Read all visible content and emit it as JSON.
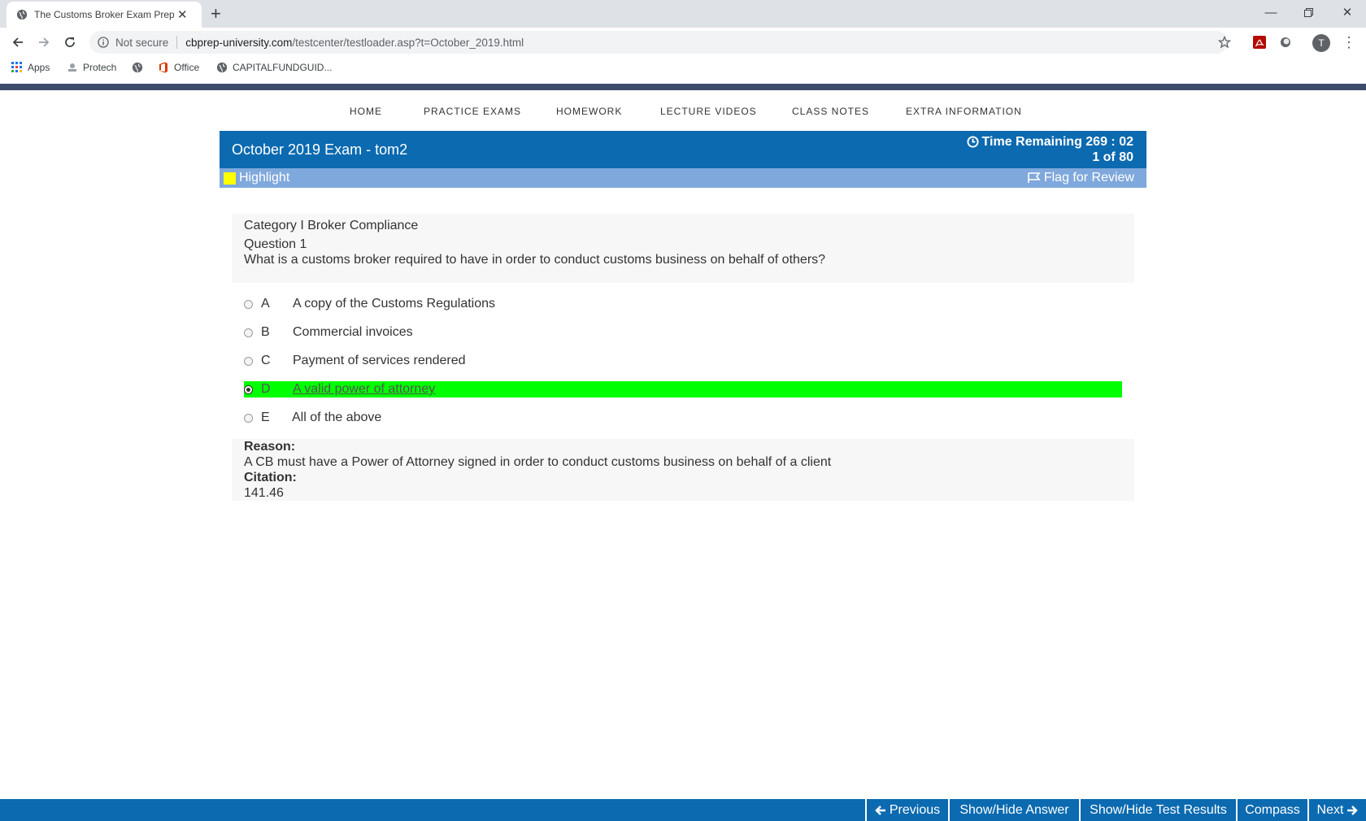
{
  "browser": {
    "tab_title": "The Customs Broker Exam Prep C",
    "security_label": "Not secure",
    "url_host": "cbprep-university.com",
    "url_path": "/testcenter/testloader.asp?t=October_2019.html",
    "profile_initial": "T",
    "bookmarks": [
      "Apps",
      "Protech",
      "Office",
      "CAPITALFUNDGUID..."
    ]
  },
  "site_nav": [
    "HOME",
    "PRACTICE EXAMS",
    "HOMEWORK",
    "LECTURE VIDEOS",
    "CLASS NOTES",
    "EXTRA INFORMATION"
  ],
  "exam": {
    "title": "October 2019 Exam  - tom2",
    "time_remaining": "Time Remaining 269 : 02",
    "progress": "1 of 80",
    "highlight_label": "Highlight",
    "flag_label": "Flag for Review"
  },
  "question": {
    "category": "Category I Broker Compliance",
    "number": "Question 1",
    "text": "What is a customs broker required to have in order to conduct customs business on behalf of others?",
    "options": [
      {
        "letter": "A",
        "text": "A copy of the Customs Regulations"
      },
      {
        "letter": "B",
        "text": "Commercial invoices"
      },
      {
        "letter": "C",
        "text": "Payment of services rendered"
      },
      {
        "letter": "D",
        "text": "A valid power of attorney"
      },
      {
        "letter": "E",
        "text": "All of the above"
      }
    ],
    "selected": "D",
    "reason_label": "Reason:",
    "reason_text": "A CB must have a Power of Attorney signed in order to conduct customs business on behalf of a client",
    "citation_label": "Citation:",
    "citation_text": "141.46"
  },
  "bottom_bar": {
    "previous": "Previous",
    "show_hide_answer": "Show/Hide Answer",
    "show_hide_results": "Show/Hide Test Results",
    "compass": "Compass",
    "next": "Next"
  },
  "colors": {
    "header_blue": "#0b6ab0",
    "highlight_bar": "#7fa8dc",
    "selected_answer": "#00ff00",
    "highlight_swatch": "#ffff00"
  }
}
